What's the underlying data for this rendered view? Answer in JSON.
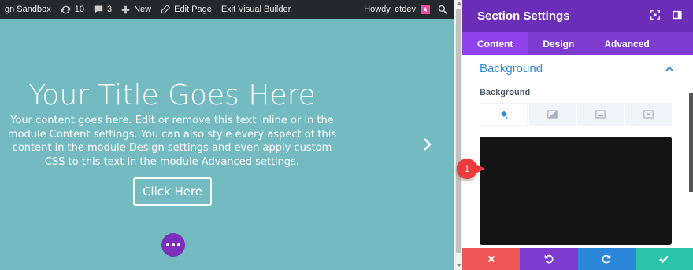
{
  "adminbar": {
    "site_name": "gn Sandbox",
    "updates_count": "10",
    "comments_count": "3",
    "new_label": "New",
    "edit_page_label": "Edit Page",
    "exit_builder_label": "Exit Visual Builder",
    "howdy_label": "Howdy, etdev",
    "icons": [
      "refresh-icon",
      "comment-icon",
      "plus-icon",
      "pencil-icon",
      "avatar",
      "search-icon"
    ]
  },
  "hero": {
    "title": "Your Title Goes Here",
    "body": "Your content goes here. Edit or remove this text inline or in the module Content settings. You can also style every aspect of this content in the module Design settings and even apply custom CSS to this text in the module Advanced settings.",
    "button_label": "Click Here",
    "background_color": "#74bac1"
  },
  "panel": {
    "title": "Section Settings",
    "tabs": [
      "Content",
      "Design",
      "Advanced"
    ],
    "active_tab": "Content",
    "section_title": "Background",
    "field_label": "Background",
    "bg_type_icons": [
      "paint-bucket-icon",
      "gradient-icon",
      "image-icon",
      "video-icon"
    ],
    "preview_color": "#141414",
    "accent_color": "#6c2eb9"
  },
  "footer": {
    "buttons": [
      "cancel",
      "undo",
      "redo",
      "save"
    ],
    "colors": [
      "#ef5555",
      "#7e3bd0",
      "#2b87da",
      "#29c4a9"
    ]
  },
  "callout": {
    "number": "1"
  }
}
